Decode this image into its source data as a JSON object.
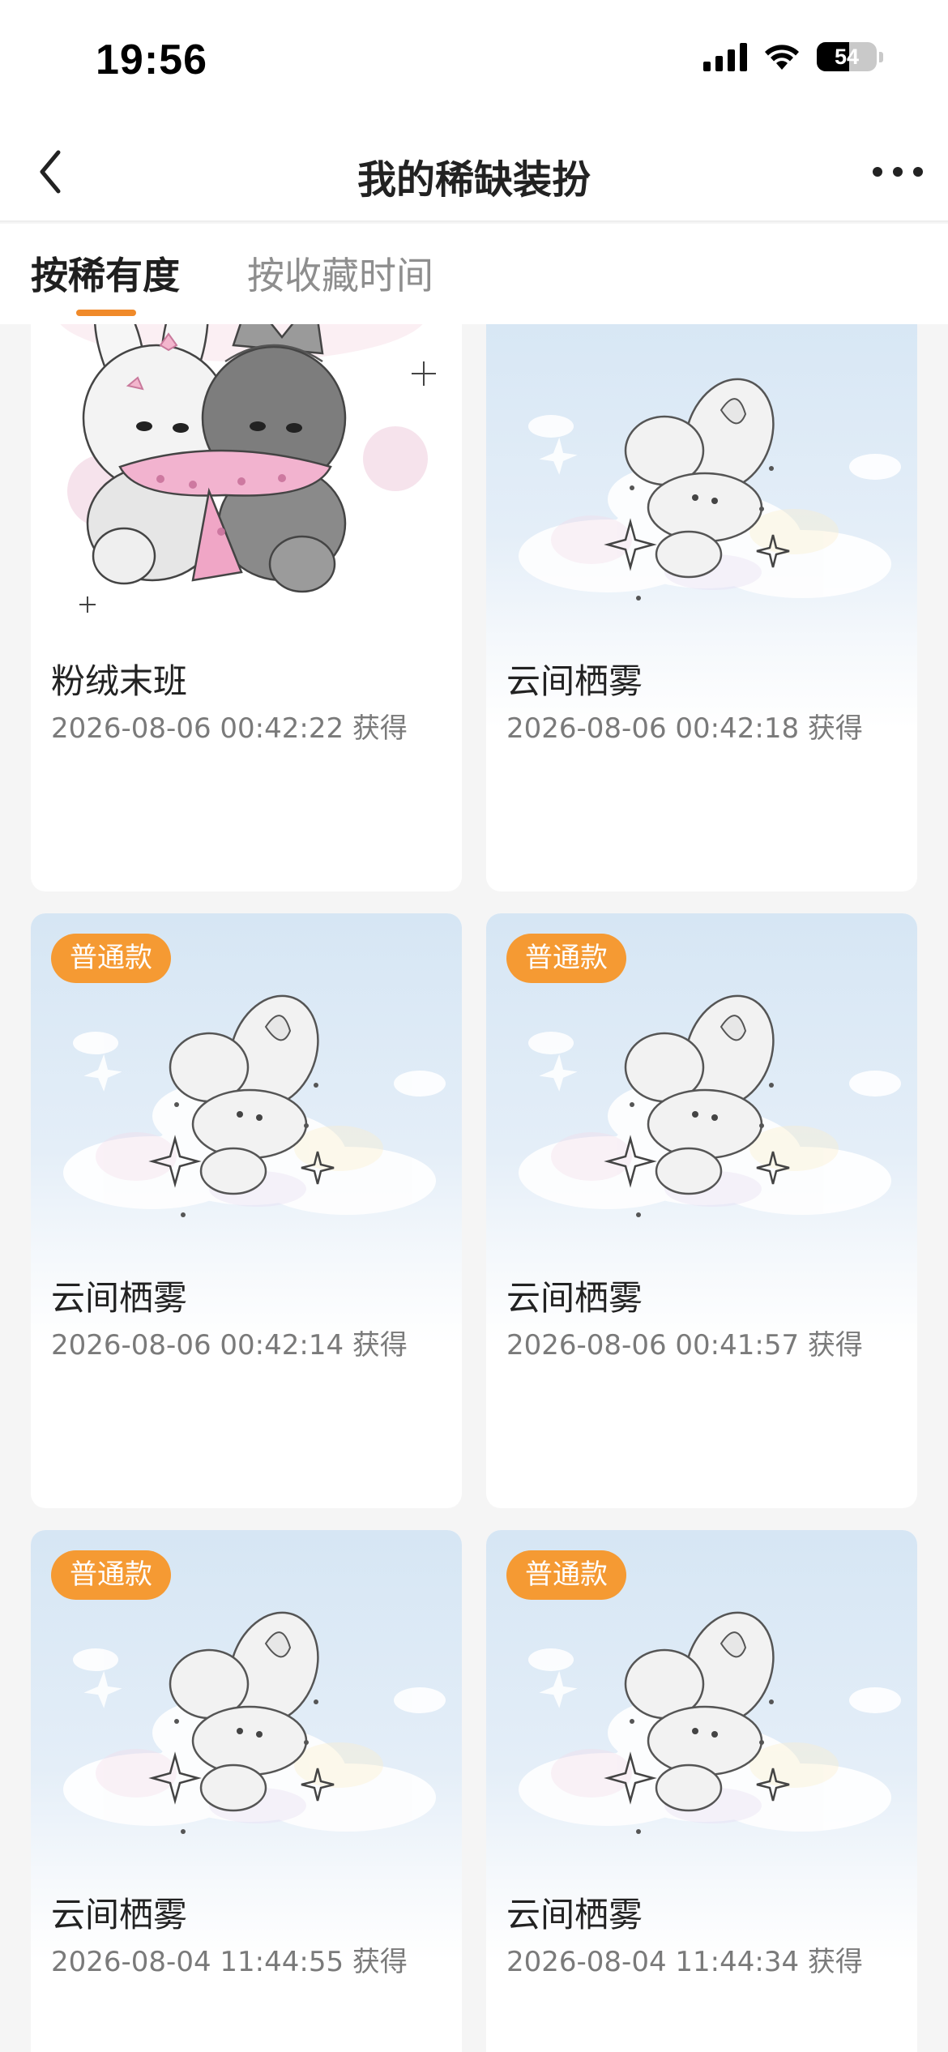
{
  "status_bar": {
    "time": "19:56",
    "battery": "54",
    "battery_level": 0.54,
    "icons": [
      "cellular-signal-icon",
      "wifi-icon",
      "battery-icon"
    ]
  },
  "nav": {
    "back_icon": "chevron-left-icon",
    "title": "我的稀缺装扮",
    "more_icon": "more-horizontal-icon"
  },
  "tabs": [
    {
      "label": "按稀有度",
      "active": true
    },
    {
      "label": "按收藏时间",
      "active": false
    }
  ],
  "colors": {
    "accent": "#f08a2a",
    "badge": "#f59a33",
    "background": "#f5f5f5",
    "card": "#ffffff"
  },
  "items": [
    {
      "name": "粉绒末班",
      "date": "2026-08-06 00:42:22 获得",
      "badge": "",
      "art": "pink-plush-pair"
    },
    {
      "name": "云间栖雾",
      "date": "2026-08-06 00:42:18 获得",
      "badge": "",
      "art": "cloud-bunny"
    },
    {
      "name": "云间栖雾",
      "date": "2026-08-06 00:42:14 获得",
      "badge": "普通款",
      "art": "cloud-bunny"
    },
    {
      "name": "云间栖雾",
      "date": "2026-08-06 00:41:57 获得",
      "badge": "普通款",
      "art": "cloud-bunny"
    },
    {
      "name": "云间栖雾",
      "date": "2026-08-04 11:44:55 获得",
      "badge": "普通款",
      "art": "cloud-bunny"
    },
    {
      "name": "云间栖雾",
      "date": "2026-08-04 11:44:34 获得",
      "badge": "普通款",
      "art": "cloud-bunny"
    }
  ]
}
